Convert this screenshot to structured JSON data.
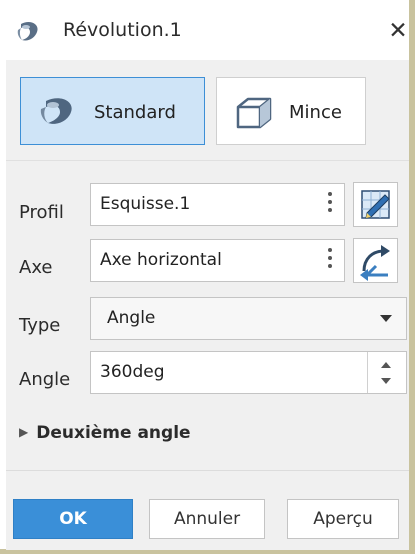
{
  "dialog": {
    "title": "Révolution.1",
    "close_icon": "close-icon"
  },
  "modes": {
    "standard_label": "Standard",
    "thin_label": "Mince",
    "active": "standard"
  },
  "params": {
    "profile_label": "Profil",
    "profile_value": "Esquisse.1",
    "axis_label": "Axe",
    "axis_value": "Axe horizontal",
    "type_label": "Type",
    "type_value": "Angle",
    "angle_label": "Angle",
    "angle_value": "360deg",
    "second_angle_label": "Deuxième angle"
  },
  "footer": {
    "ok_label": "OK",
    "cancel_label": "Annuler",
    "preview_label": "Aperçu"
  },
  "colors": {
    "accent": "#3a8fd8",
    "active_mode_bg": "#cfe4f7",
    "panel_bg": "#f0f0f0"
  }
}
